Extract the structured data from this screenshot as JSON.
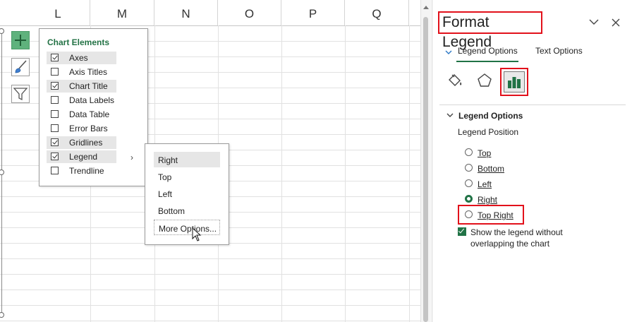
{
  "sheet": {
    "columns": [
      "L",
      "M",
      "N",
      "O",
      "P",
      "Q"
    ]
  },
  "chart_buttons": {
    "elements_icon": "plus-icon",
    "styles_icon": "brush-icon",
    "filters_icon": "funnel-icon"
  },
  "chart_elements": {
    "title": "Chart Elements",
    "items": [
      {
        "label": "Axes",
        "checked": true
      },
      {
        "label": "Axis Titles",
        "checked": false
      },
      {
        "label": "Chart Title",
        "checked": true
      },
      {
        "label": "Data Labels",
        "checked": false
      },
      {
        "label": "Data Table",
        "checked": false
      },
      {
        "label": "Error Bars",
        "checked": false
      },
      {
        "label": "Gridlines",
        "checked": true
      },
      {
        "label": "Legend",
        "checked": true
      },
      {
        "label": "Trendline",
        "checked": false
      }
    ]
  },
  "legend_submenu": {
    "items": [
      "Right",
      "Top",
      "Left",
      "Bottom",
      "More Options..."
    ],
    "selected": "Right"
  },
  "format_pane": {
    "title": "Format Legend",
    "tabs": {
      "legend_options": "Legend Options",
      "text_options": "Text Options"
    },
    "section_title": "Legend Options",
    "position_label": "Legend Position",
    "positions": [
      {
        "label": "Top",
        "checked": false
      },
      {
        "label": "Bottom",
        "checked": false
      },
      {
        "label": "Left",
        "checked": false
      },
      {
        "label": "Right",
        "checked": true
      },
      {
        "label": "Top Right",
        "checked": false
      }
    ],
    "overlap_label": "Show the legend without overlapping the chart",
    "overlap_checked": true,
    "accent_color": "#217346",
    "highlight_color": "#e2111b"
  }
}
